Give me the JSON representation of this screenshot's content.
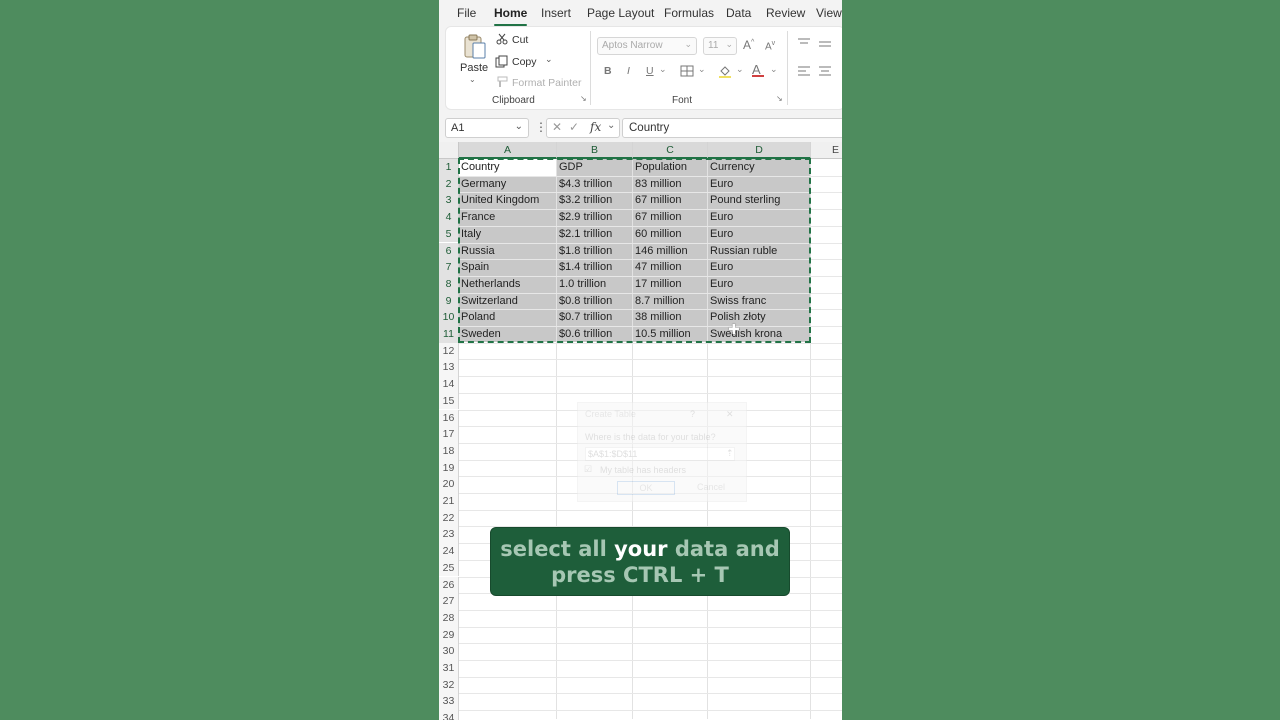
{
  "menu": {
    "tabs": [
      "File",
      "Home",
      "Insert",
      "Page Layout",
      "Formulas",
      "Data",
      "Review",
      "View"
    ],
    "active_tab": "Home"
  },
  "ribbon": {
    "clipboard": {
      "paste": "Paste",
      "cut": "Cut",
      "copy": "Copy",
      "format_painter": "Format Painter",
      "group_label": "Clipboard"
    },
    "font": {
      "font_name": "Aptos Narrow",
      "font_size": "11",
      "bold": "B",
      "italic": "I",
      "underline": "U",
      "group_label": "Font"
    }
  },
  "formula_bar": {
    "name_box": "A1",
    "fx": "fx",
    "content": "Country"
  },
  "grid": {
    "columns": [
      "A",
      "B",
      "C",
      "D",
      "E"
    ],
    "row_numbers": [
      "1",
      "2",
      "3",
      "4",
      "5",
      "6",
      "7",
      "8",
      "9",
      "10",
      "11",
      "12",
      "13",
      "14",
      "15",
      "16",
      "17",
      "18",
      "19",
      "20",
      "21",
      "22",
      "23",
      "24",
      "25",
      "26",
      "27",
      "28",
      "29",
      "30",
      "31",
      "32",
      "33",
      "34"
    ],
    "rows": [
      [
        "Country",
        "GDP",
        "Population",
        "Currency"
      ],
      [
        "Germany",
        "$4.3 trillion",
        "83 million",
        "Euro"
      ],
      [
        "United Kingdom",
        "$3.2 trillion",
        "67 million",
        "Pound sterling"
      ],
      [
        "France",
        "$2.9 trillion",
        "67 million",
        "Euro"
      ],
      [
        "Italy",
        "$2.1 trillion",
        "60 million",
        "Euro"
      ],
      [
        "Russia",
        "$1.8 trillion",
        "146 million",
        "Russian ruble"
      ],
      [
        "Spain",
        "$1.4 trillion",
        "47 million",
        "Euro"
      ],
      [
        "Netherlands",
        "1.0 trillion",
        "17 million",
        "Euro"
      ],
      [
        "Switzerland",
        "$0.8 trillion",
        "8.7 million",
        "Swiss franc"
      ],
      [
        "Poland",
        "$0.7 trillion",
        "38 million",
        "Polish złoty"
      ],
      [
        "Sweden",
        "$0.6 trillion",
        "10.5 million",
        "Swedish krona"
      ]
    ]
  },
  "dialog": {
    "title": "Create Table",
    "help": "?",
    "close": "✕",
    "prompt": "Where is the data for your table?",
    "range": "$A$1:$D$11",
    "checkbox_label": "My table has headers",
    "ok": "OK",
    "cancel": "Cancel"
  },
  "caption": {
    "part1": "select all ",
    "highlight": "your",
    "part2": " data and press CTRL + T"
  },
  "colors": {
    "accent": "#217346",
    "background": "#4e8c5e",
    "caption_bg": "#1e5e3a"
  }
}
